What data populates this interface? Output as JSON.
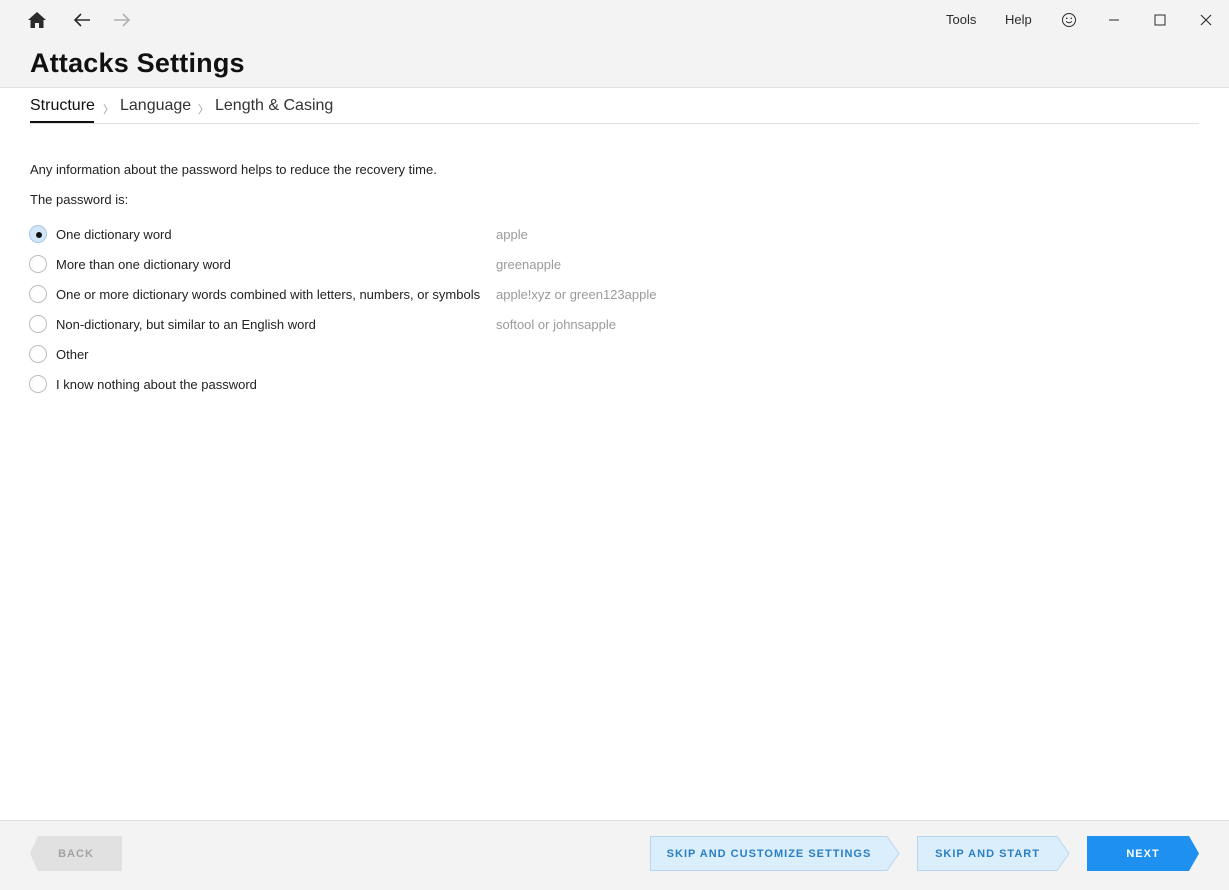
{
  "window": {
    "menu": [
      "Tools",
      "Help"
    ],
    "title": "Attacks Settings"
  },
  "breadcrumb": [
    {
      "label": "Structure",
      "active": true
    },
    {
      "label": "Language",
      "active": false
    },
    {
      "label": "Length & Casing",
      "active": false
    }
  ],
  "breadcrumb_separator": "〉",
  "content": {
    "intro": "Any information about the password helps to reduce the recovery time.",
    "prompt": "The password is:",
    "options": [
      {
        "label": "One dictionary word",
        "example": "apple",
        "checked": true
      },
      {
        "label": "More than one dictionary word",
        "example": "greenapple",
        "checked": false
      },
      {
        "label": "One or more dictionary words combined with letters, numbers, or symbols",
        "example": "apple!xyz or green123apple",
        "checked": false
      },
      {
        "label": "Non-dictionary, but similar to an English word",
        "example": "softool or johnsapple",
        "checked": false
      },
      {
        "label": "Other",
        "example": "",
        "checked": false
      },
      {
        "label": "I know nothing about the password",
        "example": "",
        "checked": false
      }
    ]
  },
  "footer": {
    "back": "BACK",
    "skip_customize": "SKIP AND CUSTOMIZE SETTINGS",
    "skip_start": "SKIP AND START",
    "next": "NEXT"
  },
  "colors": {
    "accent": "#1e90f0",
    "skip_bg": "#dbeefb",
    "skip_text": "#2a7fc4",
    "titlebar_bg": "#f3f3f3"
  },
  "icons": [
    "home-icon",
    "back-arrow-icon",
    "forward-arrow-icon",
    "smiley-icon",
    "minimize-icon",
    "maximize-icon",
    "close-icon"
  ]
}
